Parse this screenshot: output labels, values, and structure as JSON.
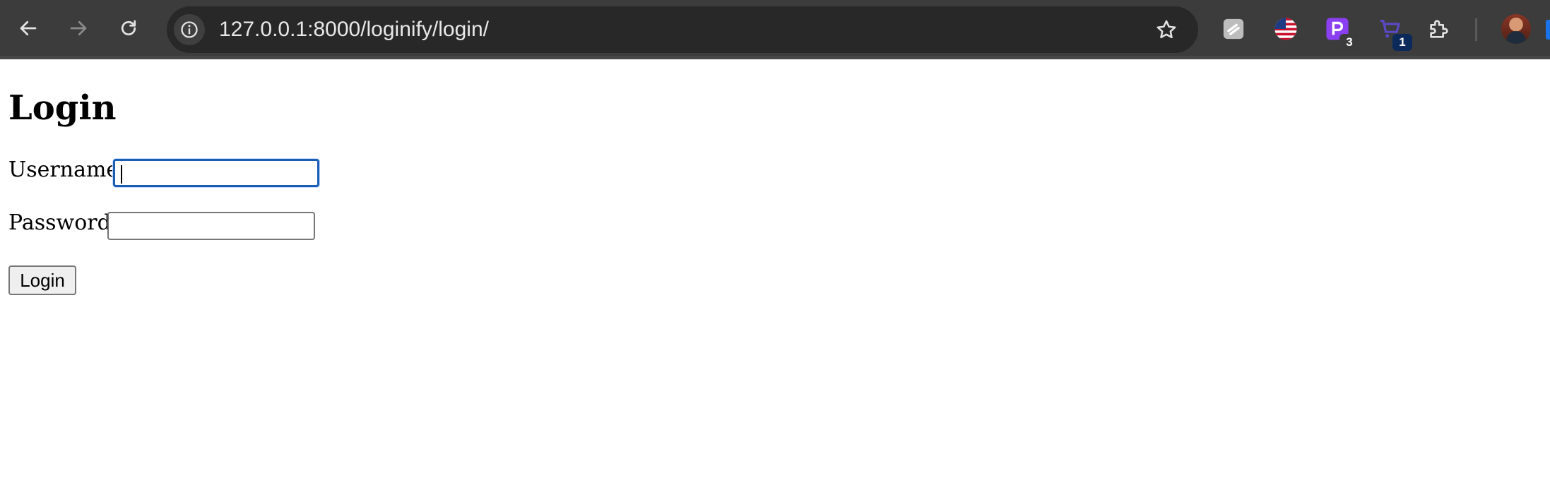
{
  "browser": {
    "url": "127.0.0.1:8000/loginify/login/",
    "nav": {
      "back_icon": "arrow-left-icon",
      "forward_icon": "arrow-right-icon",
      "reload_icon": "reload-icon"
    },
    "extensions": [
      {
        "icon": "tools-extension-icon"
      },
      {
        "icon": "flag-extension-icon"
      },
      {
        "icon": "p-extension-icon",
        "badge": "3",
        "badge_color": "#3b3b3b"
      },
      {
        "icon": "cart-extension-icon",
        "badge": "1",
        "badge_color": "#0b2a5b"
      },
      {
        "icon": "puzzle-icon"
      }
    ],
    "colors": {
      "toolbar": "#3c3c3c",
      "omnibox": "#282828",
      "focus_ring": "#1a5fb4"
    }
  },
  "page": {
    "heading": "Login",
    "username": {
      "label": "Username:",
      "value": "",
      "placeholder": ""
    },
    "password": {
      "label": "Password:",
      "value": "",
      "placeholder": ""
    },
    "submit_label": "Login"
  }
}
